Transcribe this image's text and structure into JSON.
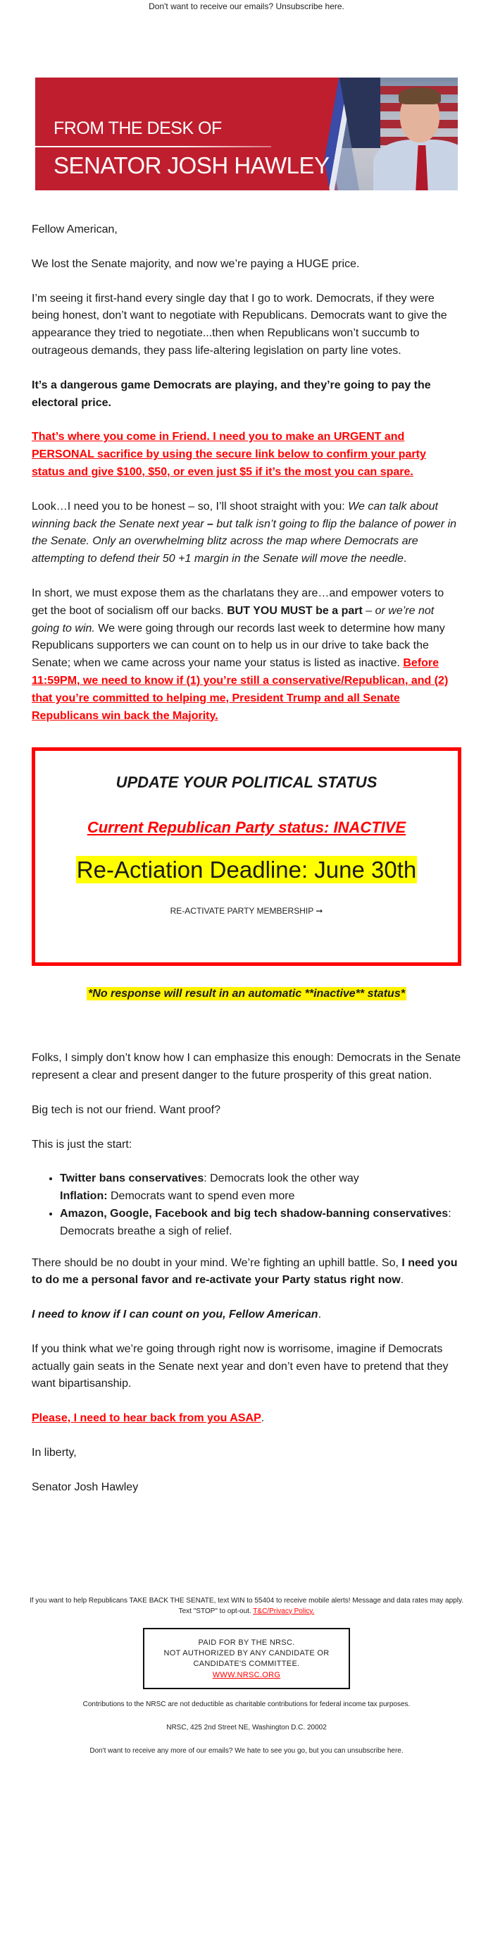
{
  "header": {
    "unsubscribe_text": "Don't want to receive our emails? Unsubscribe here."
  },
  "banner": {
    "line1": "FROM THE DESK OF",
    "line2": "SENATOR JOSH HAWLEY",
    "colors": {
      "red": "#bf1e2e",
      "blue": "#3a4ba8"
    }
  },
  "letter": {
    "greeting": "Fellow American,",
    "p1": "We lost the Senate majority, and now we’re paying a HUGE price.",
    "p2": "I’m seeing it first-hand every single day that I go to work. Democrats, if they were being honest, don’t want to negotiate with Republicans. Democrats want to give the appearance they tried to negotiate...then when Republicans won’t succumb to outrageous demands, they pass life-altering legislation on party line votes.",
    "p3": "It’s a dangerous game Democrats are playing, and they’re going to pay the electoral price.",
    "p4_link": "That’s where you come in Friend. I need you to make an URGENT and PERSONAL sacrifice by using the secure link below to confirm your party status and give $100, $50, or even just $5 if it’s the most you can spare.",
    "p5_plain": "Look…I need you to be honest – so, I’ll shoot straight with you: ",
    "p5_italic_a": "We can talk about winning back the Senate next year ",
    "p5_bold_italic": "–",
    "p5_italic_b": " but talk isn’t going to flip the balance of power in the Senate. Only an overwhelming blitz across the map where Democrats are attempting to defend their 50 +1 margin in the Senate will move the needle",
    "p5_end": ".",
    "p6_plain_a": "In short, we must expose them as the charlatans they are…and empower voters to get the boot of socialism off our backs. ",
    "p6_bold": "BUT YOU MUST be a part",
    "p6_italic": " – or we’re not going to win.",
    "p6_plain_b": " We were going through our records last week to determine how many Republicans supporters we can count on to help us in our drive to take back the Senate; when we came across your name your status is listed as inactive. ",
    "p6_link": "Before 11:59PM, we need to know if (1) you’re still a conservative/Republican, and (2) that you’re committed to helping me, President Trump and all Senate Republicans win back the Majority."
  },
  "status_box": {
    "heading": "UPDATE YOUR POLITICAL STATUS",
    "current_status": "Current Republican Party status: INACTIVE",
    "deadline": "Re-Actiation Deadline: June 30th",
    "cta_label": "RE-ACTIVATE PARTY MEMBERSHIP ➞",
    "colors": {
      "border": "#ff0000",
      "highlight": "#ffff00"
    }
  },
  "no_response_note": "*No response will result in an automatic **inactive** status*",
  "letter2": {
    "p7": "Folks, I simply don’t know how I can emphasize this enough: Democrats in the Senate represent a clear and present danger to the future prosperity of this great nation.",
    "p8": "Big tech is not our friend. Want proof?",
    "p9": "This is just the start:",
    "bullets": [
      {
        "bold": "Twitter bans conservatives",
        "text": ": Democrats look the other way",
        "sub_bold": "Inflation:",
        "sub_text": " Democrats want to spend even more"
      },
      {
        "bold": "Amazon, Google, Facebook and big tech shadow-banning conservatives",
        "text": ": Democrats breathe a sigh of relief."
      }
    ],
    "p10_plain": "There should be no doubt in your mind. We’re fighting an uphill battle. So, ",
    "p10_bold": "I need you to do me a personal favor and re-activate your Party status right now",
    "p10_end": ".",
    "p11_bold_italic": "I need to know if I can count on you, Fellow American",
    "p11_end": ".",
    "p12": "If you think what we’re going through right now is worrisome, imagine if Democrats actually gain seats in the Senate next year and don’t even have to pretend that they want bipartisanship.",
    "p13_link": "Please, I need to hear back from you ASAP",
    "p13_end": ".",
    "closing": "In liberty,",
    "signature": "Senator Josh Hawley"
  },
  "footer": {
    "sms_text": "If you want to help Republicans TAKE BACK THE SENATE, text WIN to 55404 to receive mobile alerts! Message and data rates may apply. Text \"STOP\" to opt-out. ",
    "privacy_link": "T&C/Privacy Policy.",
    "paid_line1": "PAID FOR BY THE NRSC.",
    "paid_line2": "NOT AUTHORIZED BY ANY CANDIDATE OR",
    "paid_line3": "CANDIDATE'S COMMITTEE.",
    "paid_link": "WWW.NRSC.ORG",
    "tax_note": "Contributions to the NRSC are not deductible as charitable contributions for federal income tax purposes.",
    "address": "NRSC, 425 2nd Street NE, Washington D.C. 20002",
    "unsubscribe_text": "Don't want to receive any more of our emails? We hate to see you go, but you can unsubscribe here."
  }
}
